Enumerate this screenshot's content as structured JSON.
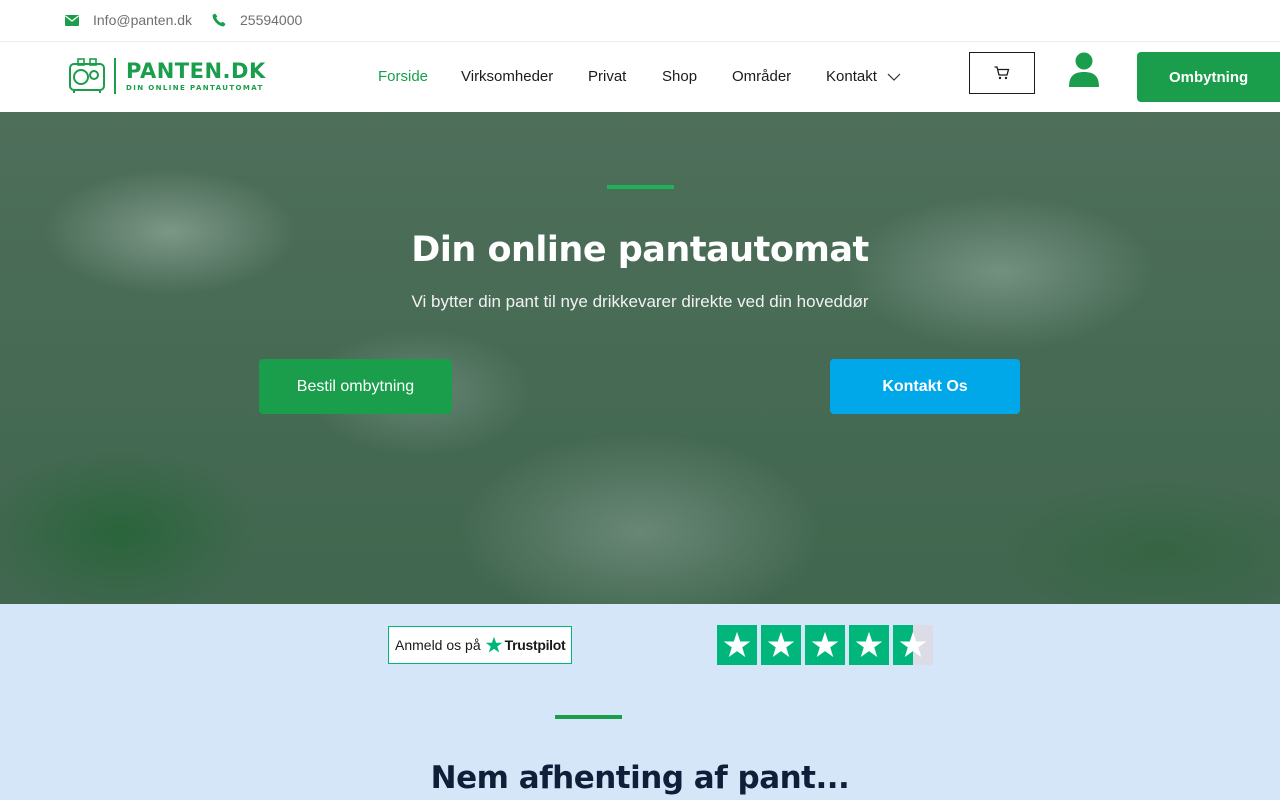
{
  "topbar": {
    "email": "Info@panten.dk",
    "phone": "25594000",
    "email_icon": "envelope-icon",
    "phone_icon": "phone-icon"
  },
  "header": {
    "logo": {
      "name": "PANTEN.DK",
      "tagline": "DIN ONLINE PANTAUTOMAT"
    },
    "nav": [
      {
        "label": "Forside",
        "active": true
      },
      {
        "label": "Virksomheder",
        "active": false
      },
      {
        "label": "Privat",
        "active": false
      },
      {
        "label": "Shop",
        "active": false
      },
      {
        "label": "Områder",
        "active": false
      },
      {
        "label": "Kontakt",
        "active": false,
        "has_dropdown": true
      }
    ],
    "cart_icon": "cart-icon",
    "user_icon": "user-icon",
    "cta_label": "Ombytning"
  },
  "hero": {
    "title": "Din online pantautomat",
    "subtitle": "Vi bytter din pant til nye drikkevarer direkte ved din hoveddør",
    "primary_button": "Bestil ombytning",
    "secondary_button": "Kontakt Os"
  },
  "reviews": {
    "widget_prefix": "Anmeld os på",
    "widget_brand": "Trustpilot",
    "rating": 4.5,
    "rating_max": 5
  },
  "section": {
    "title": "Nem afhenting af pant..."
  },
  "colors": {
    "brand_green": "#1a9e4b",
    "accent_blue": "#00a8ea",
    "trustpilot_green": "#00b67a",
    "band_bg": "#d4e6f7",
    "heading_dark": "#0f1f3a"
  }
}
